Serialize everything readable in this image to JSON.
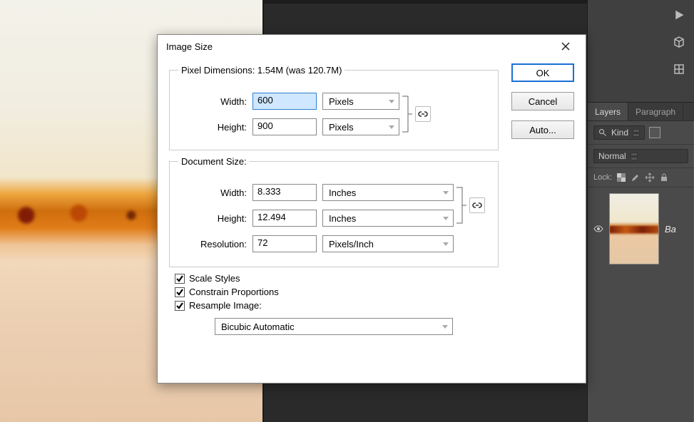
{
  "app": {
    "right_panel": {
      "tabs": {
        "layers": "Layers",
        "paragraph": "Paragraph"
      },
      "kind_filter": "Kind",
      "blend_mode": "Normal",
      "lock_label": "Lock:",
      "layer_name": "Ba"
    }
  },
  "dialog": {
    "title": "Image Size",
    "pixel_dims": {
      "legend": "Pixel Dimensions:  1.54M (was 120.7M)",
      "width_label": "Width:",
      "width_value": "600",
      "width_unit": "Pixels",
      "height_label": "Height:",
      "height_value": "900",
      "height_unit": "Pixels"
    },
    "doc_size": {
      "legend": "Document Size:",
      "width_label": "Width:",
      "width_value": "8.333",
      "width_unit": "Inches",
      "height_label": "Height:",
      "height_value": "12.494",
      "height_unit": "Inches",
      "res_label": "Resolution:",
      "res_value": "72",
      "res_unit": "Pixels/Inch"
    },
    "checks": {
      "scale_styles": "Scale Styles",
      "constrain": "Constrain Proportions",
      "resample": "Resample Image:"
    },
    "resample_method": "Bicubic Automatic",
    "buttons": {
      "ok": "OK",
      "cancel": "Cancel",
      "auto": "Auto..."
    }
  }
}
